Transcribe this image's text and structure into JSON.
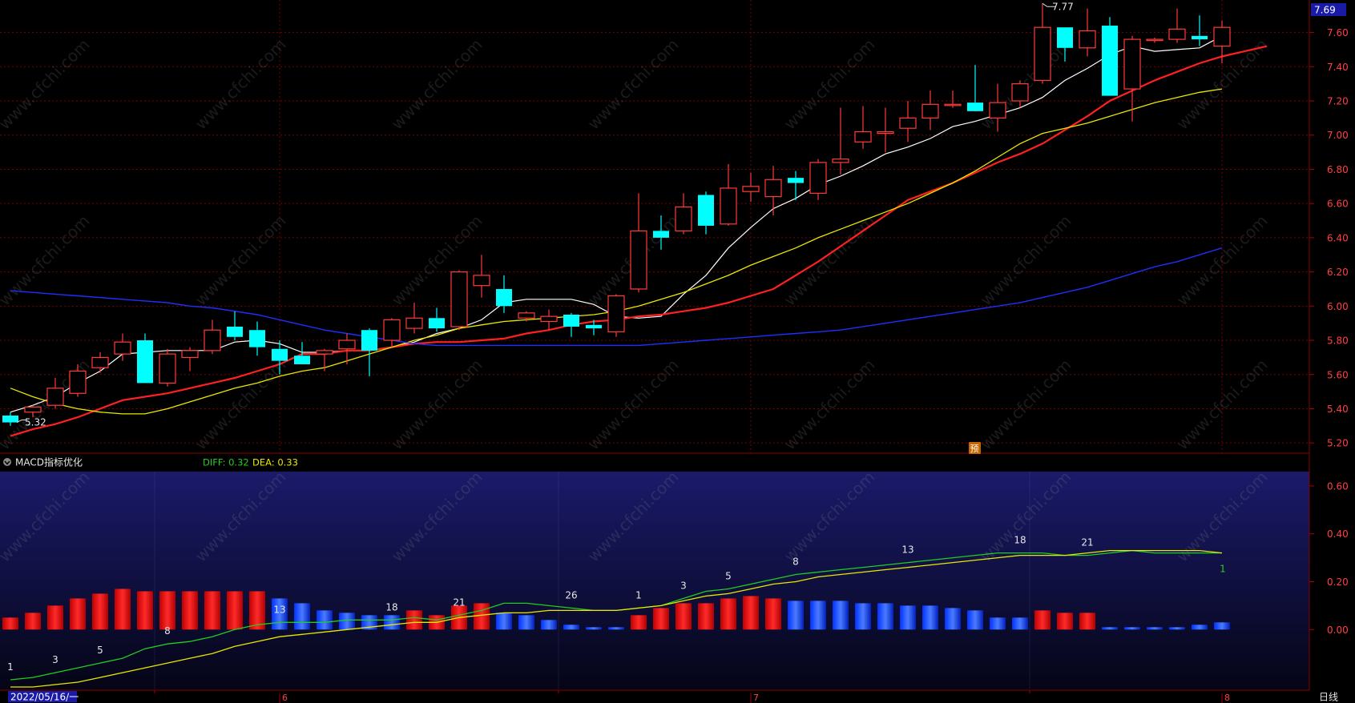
{
  "header": {
    "indicator_name": "MACD指标优化",
    "diff_label": "DIFF: 0.32",
    "dea_label": "DEA: 0.33",
    "period_label": "日线",
    "cursor_date": "2022/05/16/一",
    "last_price_tag": "7.69",
    "high_annotation": "7.77",
    "low_annotation": "5.32",
    "forecast_badge": "预",
    "watermark": "www.cfchi.com"
  },
  "colors": {
    "up": "#ff3b3b",
    "down": "#00ffff",
    "ma5": "#ffffff",
    "ma10": "#ff2020",
    "ma20": "#e8e800",
    "ma60": "#1f2fff",
    "diff": "#22cc22",
    "dea": "#e8e800",
    "grid": "#7a0000"
  },
  "chart_data": [
    {
      "type": "candlestick",
      "price_axis": {
        "ticks": [
          "5.20",
          "5.40",
          "5.60",
          "5.80",
          "6.00",
          "6.20",
          "6.40",
          "6.60",
          "6.80",
          "7.00",
          "7.20",
          "7.40",
          "7.60"
        ],
        "ylim": [
          5.14,
          7.79
        ]
      },
      "x_labels": [
        "6",
        "7",
        "8"
      ],
      "x_label_index": [
        12,
        33,
        54
      ],
      "series": [
        {
          "name": "ohlc",
          "data": [
            [
              5.36,
              5.38,
              5.3,
              5.32
            ],
            [
              5.38,
              5.42,
              5.35,
              5.41
            ],
            [
              5.42,
              5.58,
              5.4,
              5.52
            ],
            [
              5.49,
              5.66,
              5.47,
              5.62
            ],
            [
              5.64,
              5.73,
              5.61,
              5.7
            ],
            [
              5.72,
              5.84,
              5.68,
              5.79
            ],
            [
              5.8,
              5.84,
              5.55,
              5.55
            ],
            [
              5.55,
              5.75,
              5.53,
              5.72
            ],
            [
              5.7,
              5.76,
              5.62,
              5.74
            ],
            [
              5.74,
              5.92,
              5.72,
              5.86
            ],
            [
              5.88,
              5.97,
              5.8,
              5.82
            ],
            [
              5.86,
              5.91,
              5.71,
              5.76
            ],
            [
              5.75,
              5.8,
              5.6,
              5.68
            ],
            [
              5.71,
              5.79,
              5.68,
              5.66
            ],
            [
              5.72,
              5.75,
              5.62,
              5.74
            ],
            [
              5.75,
              5.84,
              5.66,
              5.8
            ],
            [
              5.86,
              5.87,
              5.59,
              5.74
            ],
            [
              5.8,
              5.93,
              5.76,
              5.92
            ],
            [
              5.87,
              6.02,
              5.84,
              5.93
            ],
            [
              5.93,
              5.99,
              5.85,
              5.87
            ],
            [
              5.88,
              6.21,
              5.86,
              6.2
            ],
            [
              6.12,
              6.3,
              6.05,
              6.18
            ],
            [
              6.1,
              6.18,
              5.96,
              6.0
            ],
            [
              5.93,
              5.97,
              5.91,
              5.96
            ],
            [
              5.91,
              5.98,
              5.86,
              5.94
            ],
            [
              5.95,
              5.96,
              5.82,
              5.88
            ],
            [
              5.89,
              5.92,
              5.83,
              5.87
            ],
            [
              5.85,
              6.07,
              5.82,
              6.06
            ],
            [
              6.1,
              6.66,
              6.08,
              6.44
            ],
            [
              6.44,
              6.53,
              6.33,
              6.4
            ],
            [
              6.44,
              6.66,
              6.42,
              6.58
            ],
            [
              6.65,
              6.67,
              6.42,
              6.47
            ],
            [
              6.48,
              6.83,
              6.47,
              6.69
            ],
            [
              6.67,
              6.78,
              6.61,
              6.7
            ],
            [
              6.64,
              6.82,
              6.53,
              6.74
            ],
            [
              6.75,
              6.79,
              6.62,
              6.72
            ],
            [
              6.66,
              6.86,
              6.62,
              6.84
            ],
            [
              6.84,
              7.16,
              6.77,
              6.86
            ],
            [
              6.96,
              7.17,
              6.92,
              7.02
            ],
            [
              7.01,
              7.16,
              6.9,
              7.02
            ],
            [
              7.04,
              7.2,
              6.96,
              7.1
            ],
            [
              7.1,
              7.26,
              7.03,
              7.18
            ],
            [
              7.18,
              7.26,
              7.16,
              7.18
            ],
            [
              7.19,
              7.41,
              7.17,
              7.14
            ],
            [
              7.1,
              7.3,
              7.02,
              7.19
            ],
            [
              7.2,
              7.32,
              7.16,
              7.3
            ],
            [
              7.32,
              7.77,
              7.3,
              7.63
            ],
            [
              7.63,
              7.63,
              7.43,
              7.51
            ],
            [
              7.51,
              7.74,
              7.46,
              7.61
            ],
            [
              7.64,
              7.69,
              7.23,
              7.23
            ],
            [
              7.27,
              7.58,
              7.08,
              7.56
            ],
            [
              7.56,
              7.57,
              7.54,
              7.56
            ],
            [
              7.56,
              7.74,
              7.54,
              7.62
            ],
            [
              7.58,
              7.7,
              7.52,
              7.56
            ],
            [
              7.52,
              7.67,
              7.42,
              7.63
            ]
          ]
        },
        {
          "name": "MA5",
          "values": [
            5.38,
            5.42,
            5.47,
            5.55,
            5.62,
            5.72,
            5.73,
            5.74,
            5.74,
            5.74,
            5.79,
            5.8,
            5.78,
            5.73,
            5.73,
            5.74,
            5.74,
            5.76,
            5.79,
            5.84,
            5.87,
            5.92,
            6.02,
            6.04,
            6.04,
            6.04,
            6.01,
            5.94,
            5.93,
            5.94,
            6.07,
            6.18,
            6.34,
            6.46,
            6.57,
            6.63,
            6.71,
            6.76,
            6.82,
            6.89,
            6.93,
            6.98,
            7.05,
            7.08,
            7.12,
            7.16,
            7.22,
            7.32,
            7.39,
            7.47,
            7.52,
            7.49,
            7.5,
            7.51,
            7.58
          ]
        },
        {
          "name": "MA10",
          "values": [
            5.24,
            5.28,
            5.31,
            5.35,
            5.4,
            5.45,
            5.47,
            5.49,
            5.52,
            5.55,
            5.58,
            5.62,
            5.66,
            5.72,
            5.72,
            5.74,
            5.74,
            5.76,
            5.78,
            5.79,
            5.79,
            5.8,
            5.81,
            5.84,
            5.86,
            5.89,
            5.91,
            5.92,
            5.94,
            5.95,
            5.97,
            5.99,
            6.02,
            6.06,
            6.1,
            6.18,
            6.26,
            6.35,
            6.44,
            6.53,
            6.62,
            6.67,
            6.72,
            6.78,
            6.84,
            6.89,
            6.95,
            7.03,
            7.11,
            7.2,
            7.26,
            7.32,
            7.37,
            7.42,
            7.46,
            7.49,
            7.52
          ]
        },
        {
          "name": "MA20",
          "values": [
            5.52,
            5.47,
            5.43,
            5.4,
            5.38,
            5.37,
            5.37,
            5.4,
            5.44,
            5.48,
            5.52,
            5.55,
            5.59,
            5.62,
            5.64,
            5.68,
            5.72,
            5.76,
            5.8,
            5.83,
            5.87,
            5.89,
            5.91,
            5.92,
            5.93,
            5.94,
            5.95,
            5.97,
            6.0,
            6.04,
            6.08,
            6.13,
            6.18,
            6.24,
            6.29,
            6.34,
            6.4,
            6.45,
            6.5,
            6.55,
            6.6,
            6.66,
            6.72,
            6.79,
            6.87,
            6.95,
            7.01,
            7.04,
            7.07,
            7.11,
            7.15,
            7.19,
            7.22,
            7.25,
            7.27
          ]
        },
        {
          "name": "MA60",
          "values": [
            6.09,
            6.08,
            6.07,
            6.06,
            6.05,
            6.04,
            6.03,
            6.02,
            6.0,
            5.99,
            5.97,
            5.95,
            5.92,
            5.89,
            5.86,
            5.84,
            5.82,
            5.8,
            5.78,
            5.77,
            5.77,
            5.77,
            5.77,
            5.77,
            5.77,
            5.77,
            5.77,
            5.77,
            5.77,
            5.78,
            5.79,
            5.8,
            5.81,
            5.82,
            5.83,
            5.84,
            5.85,
            5.86,
            5.88,
            5.9,
            5.92,
            5.94,
            5.96,
            5.98,
            6.0,
            6.02,
            6.05,
            6.08,
            6.11,
            6.15,
            6.19,
            6.23,
            6.26,
            6.3,
            6.34
          ]
        }
      ]
    },
    {
      "type": "macd",
      "y_axis": {
        "ticks": [
          "0.60",
          "0.40",
          "0.20",
          "0.00"
        ],
        "ylim": [
          -0.25,
          0.66
        ]
      },
      "series": [
        {
          "name": "DIFF",
          "values": [
            -0.21,
            -0.2,
            -0.18,
            -0.16,
            -0.14,
            -0.12,
            -0.08,
            -0.06,
            -0.05,
            -0.03,
            0.0,
            0.02,
            0.03,
            0.03,
            0.03,
            0.04,
            0.04,
            0.04,
            0.05,
            0.04,
            0.06,
            0.08,
            0.11,
            0.11,
            0.1,
            0.09,
            0.08,
            0.08,
            0.09,
            0.1,
            0.13,
            0.16,
            0.17,
            0.19,
            0.21,
            0.23,
            0.24,
            0.25,
            0.26,
            0.27,
            0.28,
            0.29,
            0.3,
            0.31,
            0.32,
            0.32,
            0.32,
            0.31,
            0.31,
            0.32,
            0.33,
            0.32,
            0.32,
            0.32,
            0.32
          ]
        },
        {
          "name": "DEA",
          "values": [
            -0.24,
            -0.24,
            -0.23,
            -0.22,
            -0.2,
            -0.18,
            -0.16,
            -0.14,
            -0.12,
            -0.1,
            -0.07,
            -0.05,
            -0.03,
            -0.02,
            -0.01,
            0.0,
            0.01,
            0.02,
            0.03,
            0.03,
            0.05,
            0.06,
            0.07,
            0.07,
            0.08,
            0.08,
            0.08,
            0.08,
            0.09,
            0.1,
            0.12,
            0.14,
            0.15,
            0.17,
            0.19,
            0.2,
            0.22,
            0.23,
            0.24,
            0.25,
            0.26,
            0.27,
            0.28,
            0.29,
            0.3,
            0.31,
            0.31,
            0.31,
            0.32,
            0.33,
            0.33,
            0.33,
            0.33,
            0.33,
            0.32
          ]
        },
        {
          "name": "MACD",
          "values": [
            0.05,
            0.07,
            0.1,
            0.13,
            0.15,
            0.17,
            0.16,
            0.16,
            0.16,
            0.16,
            0.16,
            0.16,
            -0.13,
            -0.11,
            -0.08,
            -0.07,
            -0.06,
            -0.06,
            0.08,
            0.06,
            0.1,
            0.11,
            -0.07,
            -0.06,
            -0.04,
            -0.02,
            -0.01,
            -0.01,
            0.06,
            0.09,
            0.11,
            0.11,
            0.13,
            0.14,
            0.13,
            -0.12,
            -0.12,
            -0.12,
            -0.11,
            -0.11,
            -0.1,
            -0.1,
            -0.09,
            -0.08,
            -0.05,
            -0.05,
            0.08,
            0.07,
            0.07,
            -0.01,
            -0.01,
            -0.01,
            -0.01,
            -0.02,
            -0.03
          ]
        }
      ]
    }
  ],
  "count_labels": {
    "diff_side": [
      {
        "i": 0,
        "t": "1"
      },
      {
        "i": 2,
        "t": "3"
      },
      {
        "i": 4,
        "t": "5"
      },
      {
        "i": 7,
        "t": "8"
      },
      {
        "i": 12,
        "t": "13"
      },
      {
        "i": 17,
        "t": "18"
      },
      {
        "i": 20,
        "t": "21"
      },
      {
        "i": 25,
        "t": "26"
      },
      {
        "i": 28,
        "t": "1"
      },
      {
        "i": 30,
        "t": "3"
      },
      {
        "i": 32,
        "t": "5"
      },
      {
        "i": 35,
        "t": "8"
      },
      {
        "i": 40,
        "t": "13"
      },
      {
        "i": 45,
        "t": "18"
      },
      {
        "i": 48,
        "t": "21"
      }
    ],
    "end_label": "1"
  }
}
